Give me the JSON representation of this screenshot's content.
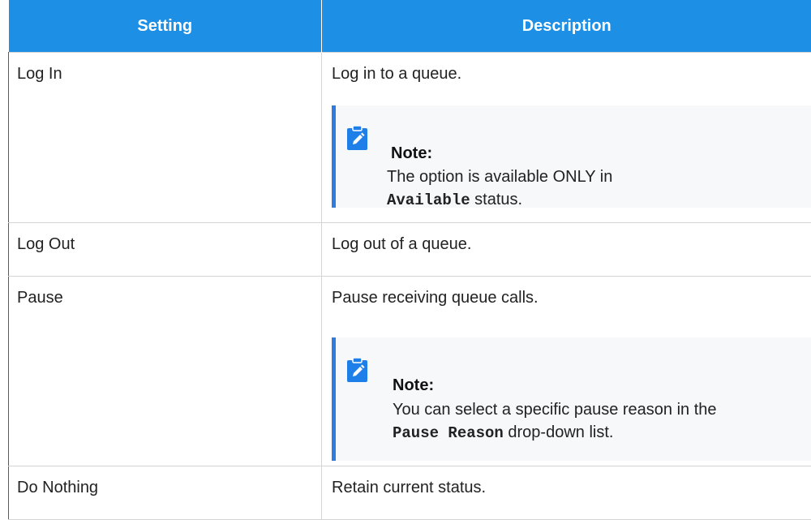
{
  "table": {
    "headers": {
      "setting": "Setting",
      "description": "Description"
    },
    "rows": [
      {
        "setting": "Log In",
        "description": "Log in to a queue.",
        "note": {
          "title": "Note:",
          "text_before": "The option is available ONLY in",
          "code": "Available",
          "text_after": " status."
        }
      },
      {
        "setting": "Log Out",
        "description": "Log out of a queue."
      },
      {
        "setting": "Pause",
        "description": "Pause receiving queue calls.",
        "note": {
          "title": "Note:",
          "text_before": "You can select a specific pause reason in the ",
          "code": "Pause Reason",
          "text_after": " drop-down list."
        }
      },
      {
        "setting": "Do Nothing",
        "description": "Retain current status."
      }
    ]
  },
  "icons": {
    "note": "edit-note-icon"
  },
  "colors": {
    "header_bg": "#1d8fe5",
    "note_bar": "#2f7bdf",
    "note_icon": "#1e7fe8",
    "note_bg": "#f7f8fa"
  }
}
